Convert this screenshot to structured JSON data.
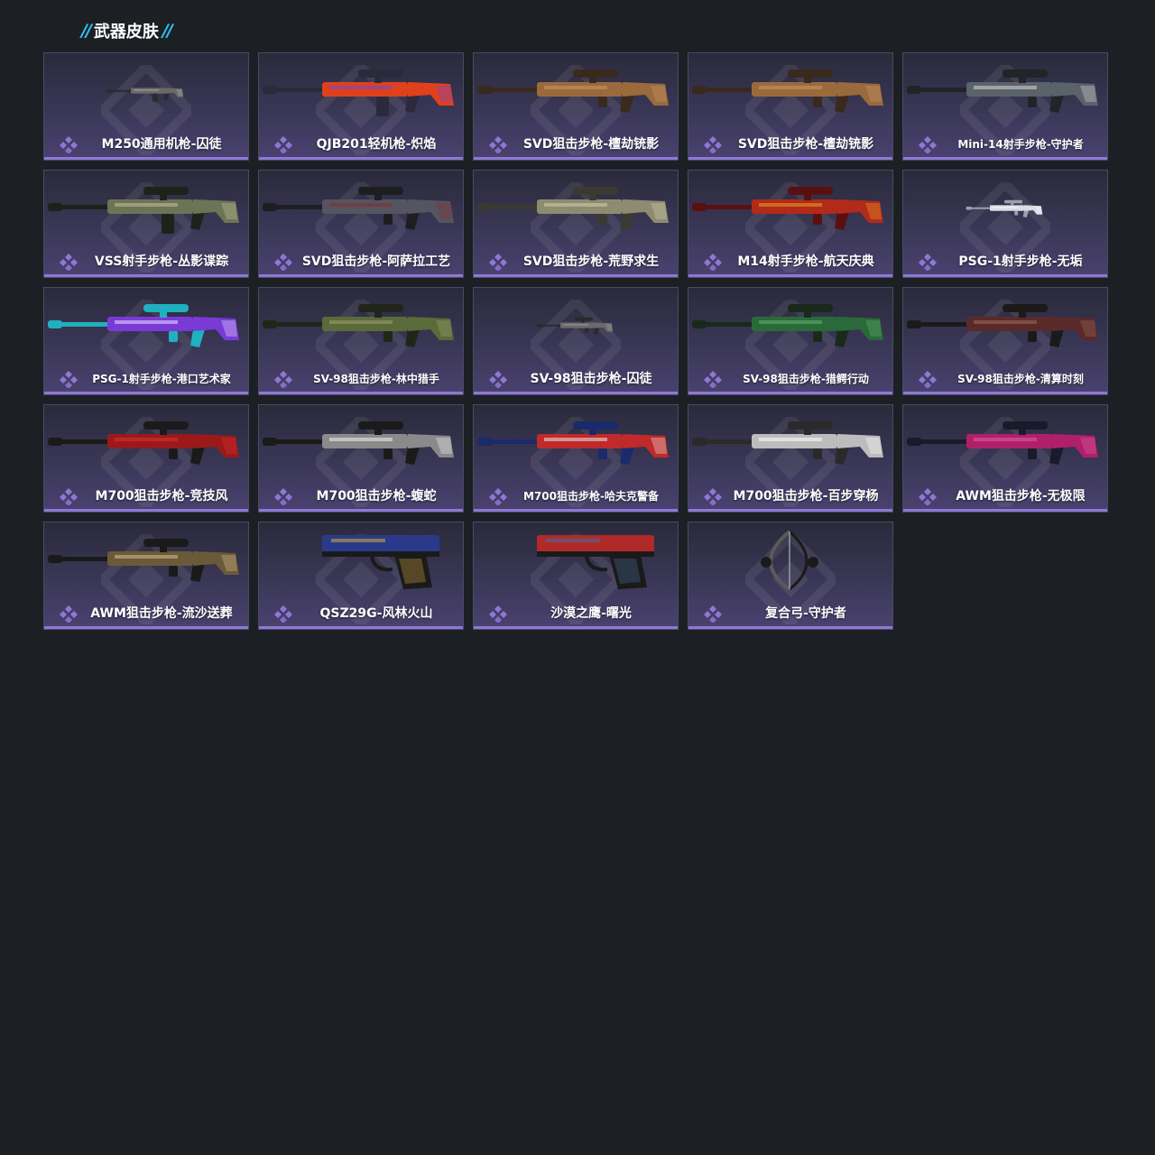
{
  "section": {
    "title": "武器皮肤",
    "accent_color": "#2ec3f0"
  },
  "colors": {
    "page_bg": "#1c2025",
    "card_border": "#4a4b63",
    "rarity_purple": "#8f77d6"
  },
  "skins": [
    {
      "name": "M250通用机枪-囚徒",
      "icon": "lmg-icon",
      "palette": [
        "#2b2b2b",
        "#6a6a6a",
        "#b0b0b0"
      ]
    },
    {
      "name": "QJB201轻机枪-炽焰",
      "icon": "lmg-icon",
      "palette": [
        "#2a2a3a",
        "#e0401c",
        "#6a4bd6"
      ]
    },
    {
      "name": "SVD狙击步枪-檀劫铳影",
      "icon": "sniper-icon",
      "palette": [
        "#3a2a1e",
        "#9a6a3c",
        "#c89866"
      ]
    },
    {
      "name": "SVD狙击步枪-檀劫铳影",
      "icon": "sniper-icon",
      "palette": [
        "#3a2a1e",
        "#9a6a3c",
        "#c89866"
      ]
    },
    {
      "name": "Mini-14射手步枪-守护者",
      "icon": "dmr-icon",
      "palette": [
        "#222428",
        "#5a626a",
        "#d8d8d8"
      ]
    },
    {
      "name": "VSS射手步枪-丛影谍踪",
      "icon": "rifle-icon",
      "palette": [
        "#1e221a",
        "#6c7456",
        "#c8c0a0"
      ]
    },
    {
      "name": "SVD狙击步枪-阿萨拉工艺",
      "icon": "sniper-icon",
      "palette": [
        "#1e1e22",
        "#555562",
        "#8a2a2a"
      ]
    },
    {
      "name": "SVD狙击步枪-荒野求生",
      "icon": "sniper-icon",
      "palette": [
        "#3a3a30",
        "#8e8c70",
        "#d0ccb0"
      ]
    },
    {
      "name": "M14射手步枪-航天庆典",
      "icon": "dmr-icon",
      "palette": [
        "#5a1010",
        "#b22a1a",
        "#e8a020"
      ]
    },
    {
      "name": "PSG-1射手步枪-无垢",
      "icon": "dmr-icon",
      "palette": [
        "#9aa0b0",
        "#d8dce4",
        "#ffffff"
      ]
    },
    {
      "name": "PSG-1射手步枪-港口艺术家",
      "icon": "dmr-icon",
      "palette": [
        "#20b0c0",
        "#7a3ad6",
        "#e8e0ff"
      ]
    },
    {
      "name": "SV-98狙击步枪-林中猎手",
      "icon": "sniper-icon",
      "palette": [
        "#22261a",
        "#5a6a3a",
        "#a0a070"
      ]
    },
    {
      "name": "SV-98狙击步枪-囚徒",
      "icon": "sniper-icon",
      "palette": [
        "#2a2a2a",
        "#6a6a6a",
        "#a0a0a0"
      ]
    },
    {
      "name": "SV-98狙击步枪-猎鳄行动",
      "icon": "sniper-icon",
      "palette": [
        "#1a2a1a",
        "#2a6a3a",
        "#60b070"
      ]
    },
    {
      "name": "SV-98狙击步枪-清算时刻",
      "icon": "sniper-icon",
      "palette": [
        "#1a1a1a",
        "#5a2a2a",
        "#a06a5a"
      ]
    },
    {
      "name": "M700狙击步枪-竞技风",
      "icon": "sniper-icon",
      "palette": [
        "#1a1a1a",
        "#9a1a1a",
        "#e03030"
      ]
    },
    {
      "name": "M700狙击步枪-蝮蛇",
      "icon": "sniper-icon",
      "palette": [
        "#1a1a1a",
        "#8a8a8a",
        "#f0f0f0"
      ]
    },
    {
      "name": "M700狙击步枪-哈夫克警备",
      "icon": "sniper-icon",
      "palette": [
        "#1a2a6a",
        "#c02a2a",
        "#e8e8e8"
      ]
    },
    {
      "name": "M700狙击步枪-百步穿杨",
      "icon": "sniper-icon",
      "palette": [
        "#2a2a2a",
        "#bcbcbc",
        "#ffffff"
      ]
    },
    {
      "name": "AWM狙击步枪-无极限",
      "icon": "sniper-icon",
      "palette": [
        "#1a1a2a",
        "#b0206a",
        "#e060a0"
      ]
    },
    {
      "name": "AWM狙击步枪-流沙送葬",
      "icon": "sniper-icon",
      "palette": [
        "#1a1a1a",
        "#6a5a3a",
        "#d8c090"
      ]
    },
    {
      "name": "QSZ29G-风林火山",
      "icon": "pistol-icon",
      "palette": [
        "#1a1a1a",
        "#2a3a8a",
        "#c8a040"
      ]
    },
    {
      "name": "沙漠之鹰-曙光",
      "icon": "pistol-icon",
      "palette": [
        "#1a1a1a",
        "#b02a2a",
        "#4a6a9a"
      ]
    },
    {
      "name": "复合弓-守护者",
      "icon": "bow-icon",
      "palette": [
        "#1a1a1a",
        "#5a5a5a",
        "#9a9a9a"
      ]
    }
  ]
}
